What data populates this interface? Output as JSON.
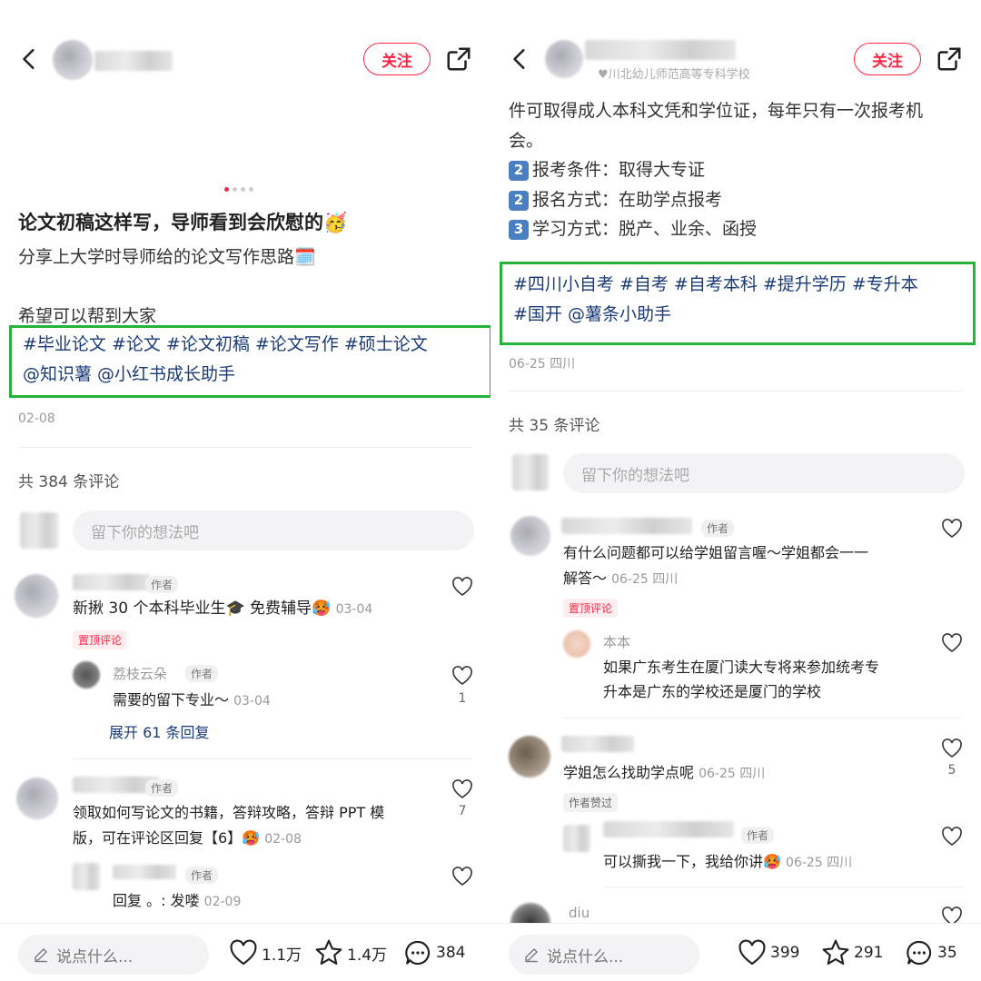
{
  "left": {
    "header": {
      "follow_label": "关注"
    },
    "title": "论文初稿这样写，导师看到会欣慰的🥳",
    "subtitle": "分享上大学时导师给的论文写作思路🗓️",
    "body": "希望可以帮到大家",
    "tags_line1": "#毕业论文  #论文  #论文初稿  #论文写作  #硕士论文",
    "tags_line2": "@知识薯 @小红书成长助手",
    "date": "02-08",
    "comment_count": "共 384 条评论",
    "input_placeholder": "留下你的想法吧",
    "comments": [
      {
        "badge": "作者",
        "text": "新揪 30 个本科毕业生🎓 免费辅导🥵",
        "date": "03-04",
        "pin": "置顶评论",
        "reply": {
          "name": "荔枝云朵",
          "badge": "作者",
          "text": "需要的留下专业～",
          "date": "03-04",
          "likes": "1"
        },
        "expand": "展开 61 条回复"
      },
      {
        "badge": "作者",
        "text1": "领取如何写论文的书籍，答辩攻略，答辩 PPT 模",
        "text2": "版，可在评论区回复【6】🥵",
        "date": "02-08",
        "likes": "7",
        "reply": {
          "badge": "作者",
          "text": "回复 。: 发喽",
          "date": "02-09"
        }
      }
    ],
    "bottom": {
      "say": "说点什么...",
      "likes": "1.1万",
      "stars": "1.4万",
      "comments": "384"
    }
  },
  "right": {
    "header": {
      "follow_label": "关注",
      "subtitle": "川北幼儿师范高等专科学校"
    },
    "body1": "件可取得成人本科文凭和学位证，每年只有一次报考机",
    "body2": "会。",
    "items": [
      {
        "num": "2",
        "text": "报考条件：取得大专证"
      },
      {
        "num": "2",
        "text": "报名方式：在助学点报考"
      },
      {
        "num": "3",
        "text": "学习方式：脱产、业余、函授"
      }
    ],
    "tags_line1": "#四川小自考  #自考  #自考本科  #提升学历  #专升本",
    "tags_line2": "#国开  @薯条小助手",
    "date": "06-25 四川",
    "comment_count": "共 35 条评论",
    "input_placeholder": "留下你的想法吧",
    "comments": [
      {
        "badge": "作者",
        "text1": "有什么问题都可以给学姐留言喔～学姐都会一一",
        "text2": "解答～",
        "date": "06-25 四川",
        "pin": "置顶评论",
        "reply": {
          "name": "本本",
          "text1": "如果广东考生在厦门读大专将来参加统考专",
          "text2": "升本是广东的学校还是厦门的学校"
        }
      },
      {
        "text": "学姐怎么找助学点呢",
        "date": "06-25 四川",
        "likes": "5",
        "liked_badge": "作者赞过",
        "reply": {
          "badge": "作者",
          "text": "可以撕我一下，我给你讲🥵",
          "date": "06-25 四川"
        }
      },
      {
        "name": "diu"
      }
    ],
    "bottom": {
      "say": "说点什么...",
      "likes": "399",
      "stars": "291",
      "comments": "35"
    }
  }
}
